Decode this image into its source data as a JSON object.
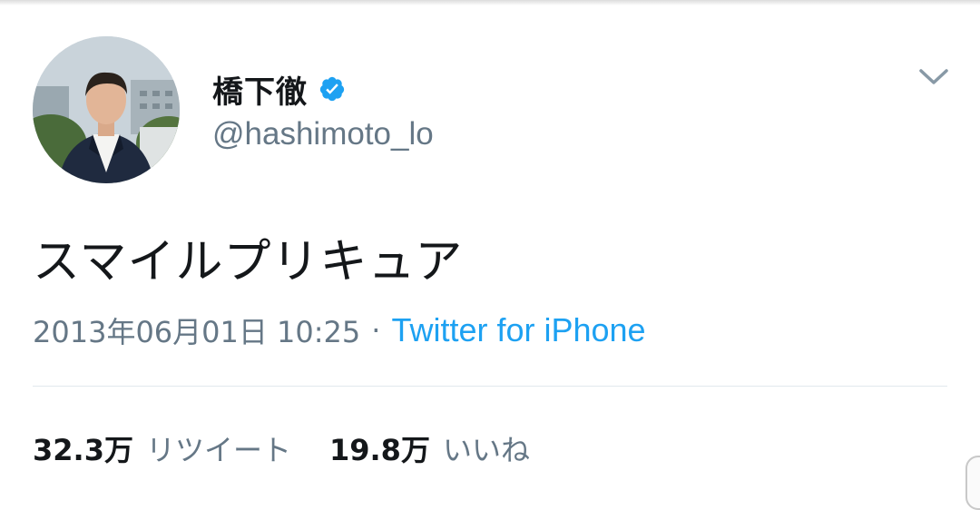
{
  "tweet": {
    "author": {
      "display_name": "橋下徹",
      "handle": "@hashimoto_lo",
      "verified": true,
      "verified_icon": "verified-badge-icon",
      "avatar": "profile-photo"
    },
    "menu_icon": "chevron-down-icon",
    "text": "スマイルプリキュア",
    "timestamp": "2013年06月01日 10:25",
    "separator": "·",
    "client": "Twitter for iPhone",
    "stats": {
      "retweets": {
        "count": "32.3万",
        "label": "リツイート"
      },
      "likes": {
        "count": "19.8万",
        "label": "いいね"
      }
    }
  },
  "colors": {
    "text_primary": "#14171a",
    "text_secondary": "#657786",
    "link": "#1da1f2",
    "verified": "#1da1f2",
    "divider": "#e1e8ed"
  }
}
